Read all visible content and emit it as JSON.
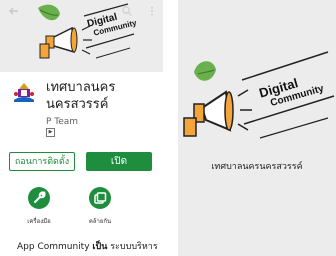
{
  "store": {
    "banner_text": [
      "Digital",
      "Community"
    ],
    "app_title": "เทศบาลนครนครสวรรค์",
    "developer": "P Team",
    "content_badge": "▶",
    "uninstall_label": "ถอนการติดตั้ง",
    "open_label": "เปิด",
    "quick_links": [
      {
        "label": "เครื่องมือ",
        "icon": "wrench-icon"
      },
      {
        "label": "คล้ายกัน",
        "icon": "similar-apps-icon"
      }
    ],
    "description_plain": "App Community ",
    "description_bold": "เป็น",
    "description_rest": " ระบบบริหาร",
    "top_icons": [
      "back-arrow-icon",
      "search-icon",
      "more-vert-icon"
    ]
  },
  "splash": {
    "logo_text": [
      "Digital",
      "Community"
    ],
    "caption": "เทศบาลนครนครสวรรค์"
  },
  "colors": {
    "accent": "#1e8e3e",
    "banner_bg": "#ececec",
    "megaphone_orange": "#f3a53a",
    "leaf_green": "#6ab04c"
  }
}
